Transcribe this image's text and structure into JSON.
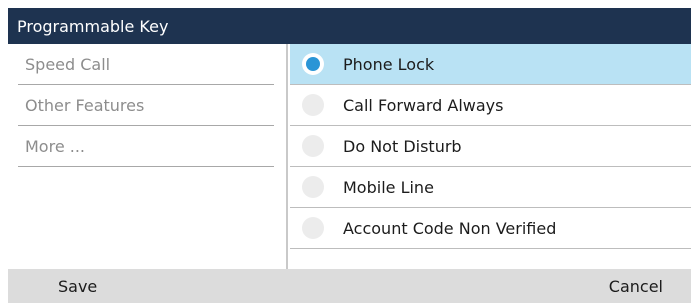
{
  "header": {
    "title": "Programmable Key"
  },
  "menu": {
    "items": [
      {
        "label": "Speed Call"
      },
      {
        "label": "Other Features"
      },
      {
        "label": "More ..."
      }
    ]
  },
  "options": {
    "selected_index": 0,
    "items": [
      {
        "label": "Phone Lock"
      },
      {
        "label": "Call Forward Always"
      },
      {
        "label": "Do Not Disturb"
      },
      {
        "label": "Mobile Line"
      },
      {
        "label": "Account Code Non Verified"
      }
    ]
  },
  "footer": {
    "save_label": "Save",
    "cancel_label": "Cancel"
  },
  "colors": {
    "title_bar": "#1e3350",
    "selected_row": "#b9e2f4",
    "radio_selected": "#2a95d6",
    "footer_bg": "#dcdcdc"
  }
}
